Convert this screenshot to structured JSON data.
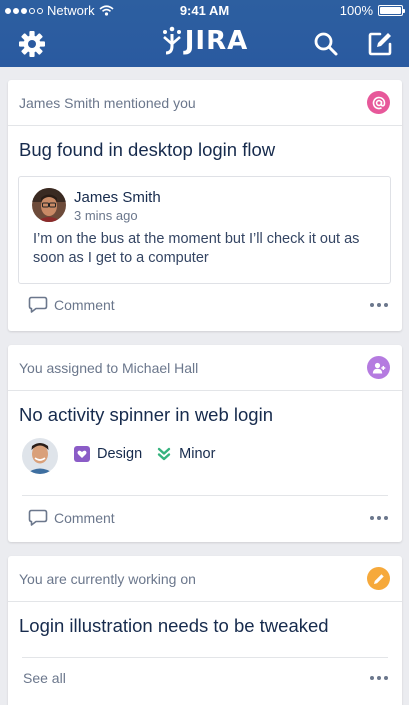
{
  "status_bar": {
    "carrier": "Network",
    "time": "9:41 AM",
    "battery": "100%"
  },
  "nav": {
    "logo_text": "JIRA",
    "icons": [
      "gear-icon",
      "search-icon",
      "compose-icon"
    ]
  },
  "colors": {
    "header": "#2A5AA0",
    "mention_badge": "#E7589A",
    "assign_badge": "#B57BE0",
    "working_badge": "#F6A93B",
    "design_tag": "#8B5CC7",
    "minor_priority": "#36B37E"
  },
  "cards": [
    {
      "header": "James Smith mentioned you",
      "title": "Bug found in desktop login flow",
      "comment": {
        "author": "James Smith",
        "time": "3 mins ago",
        "text": "I’m on the bus at the moment but I’ll check it out as soon as I get to a computer"
      },
      "action": "Comment"
    },
    {
      "header": "You assigned to Michael Hall",
      "title": "No activity spinner in web login",
      "tags": [
        "Design",
        "Minor"
      ],
      "action": "Comment"
    },
    {
      "header": "You are currently working on",
      "title": "Login illustration needs to be tweaked",
      "action": "See all"
    }
  ]
}
